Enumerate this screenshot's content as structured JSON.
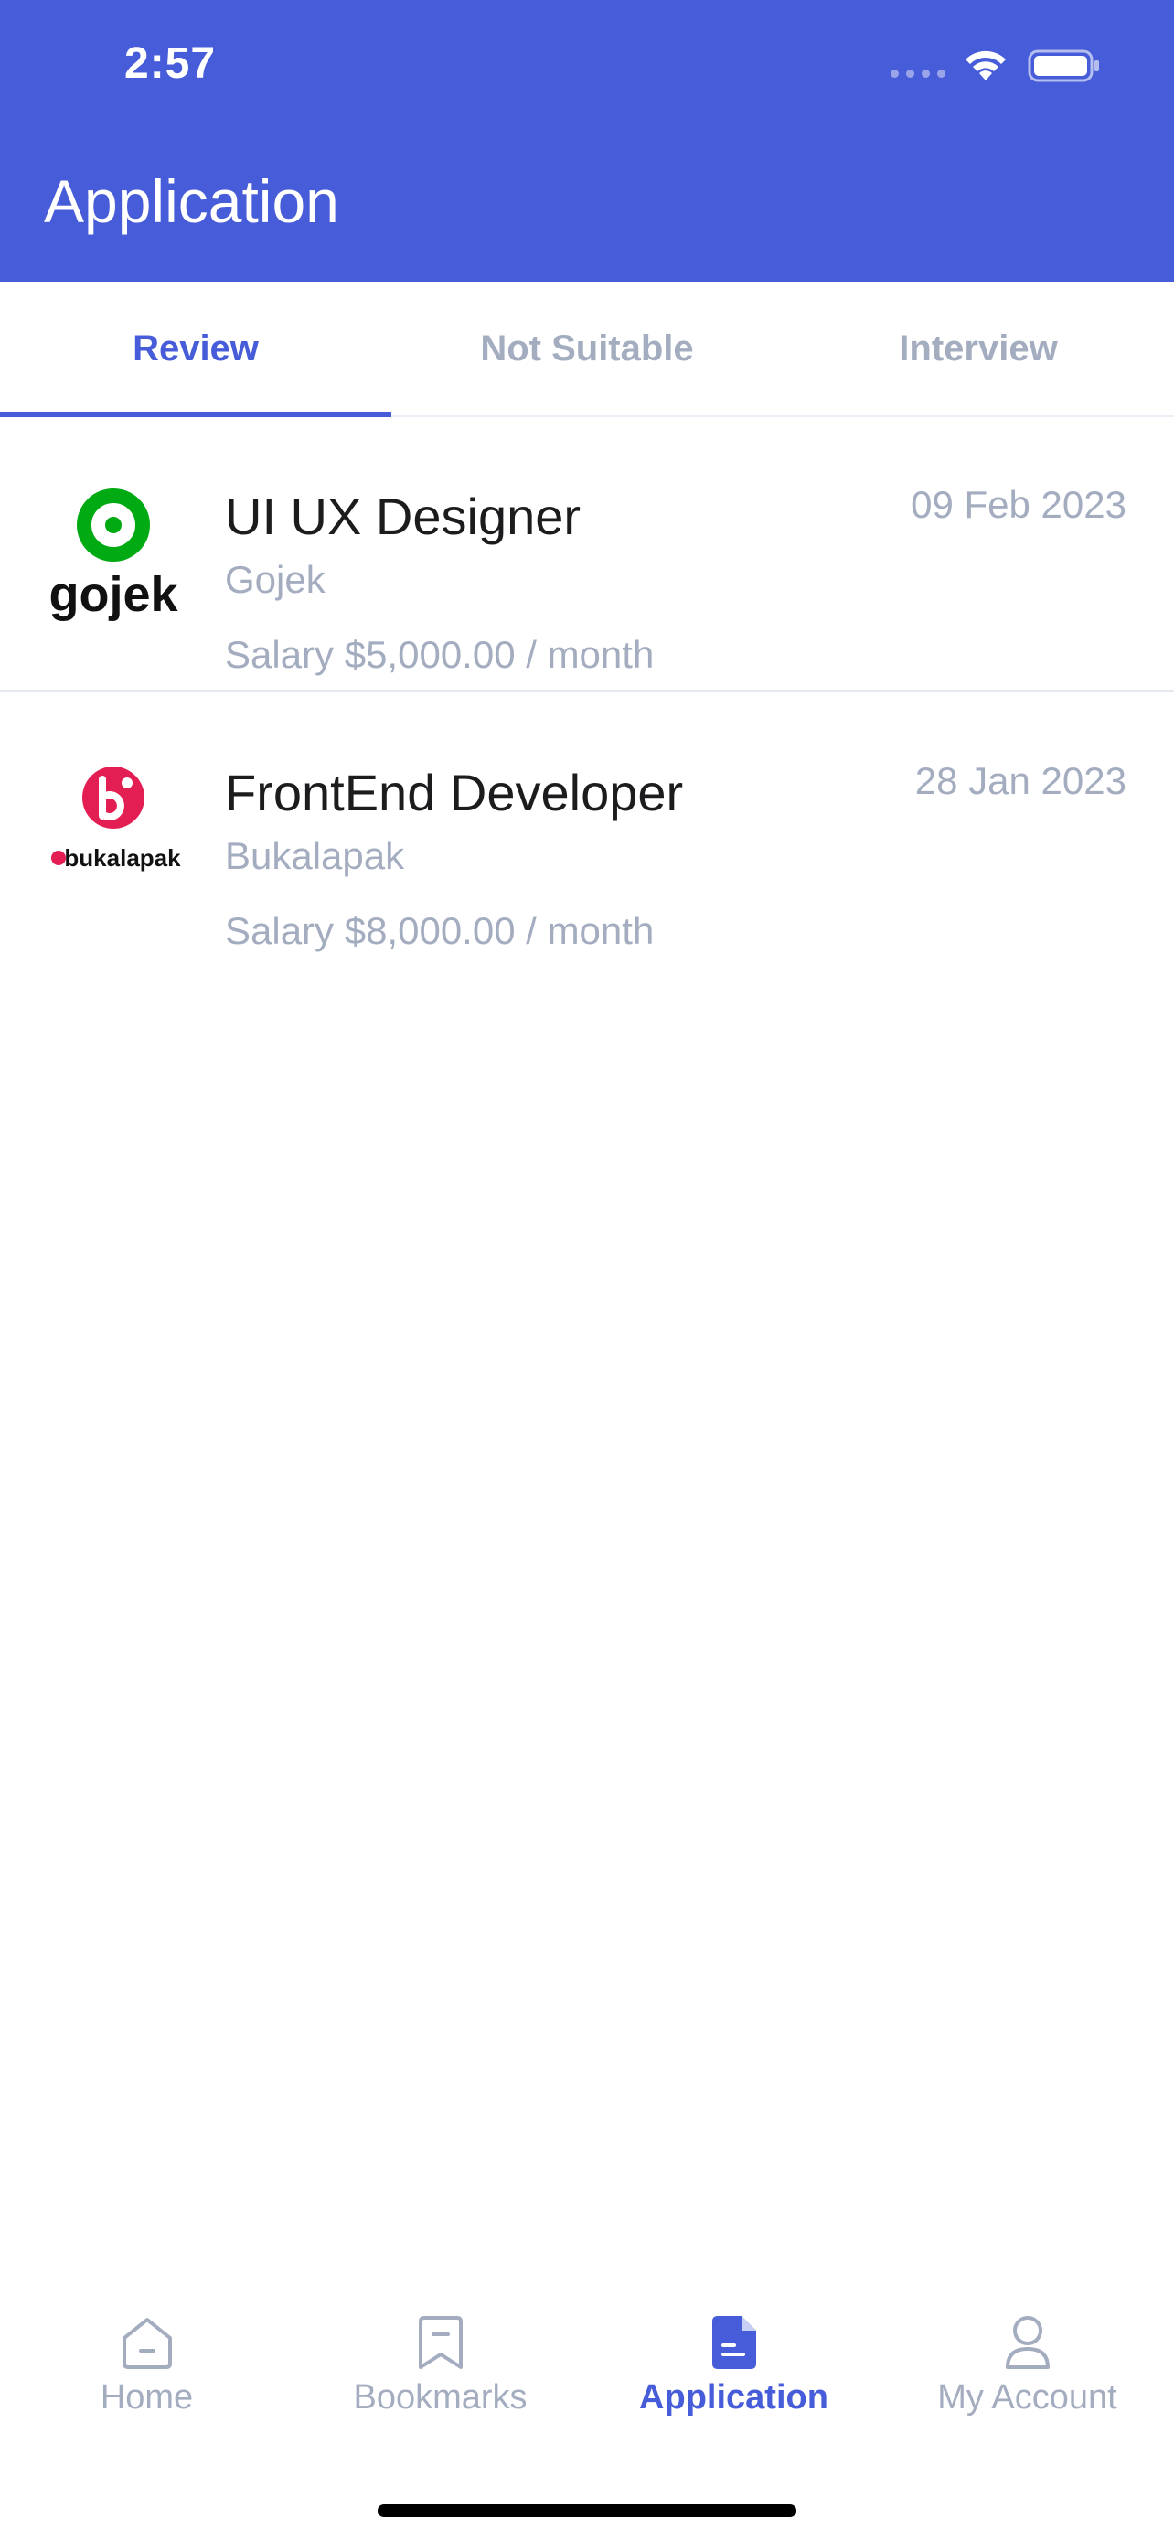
{
  "status_bar": {
    "time": "2:57"
  },
  "header": {
    "title": "Application"
  },
  "tabs": [
    {
      "label": "Review",
      "active": true
    },
    {
      "label": "Not Suitable",
      "active": false
    },
    {
      "label": "Interview",
      "active": false
    }
  ],
  "jobs": [
    {
      "title": "UI UX Designer",
      "company": "Gojek",
      "salary": "Salary $5,000.00 / month",
      "date": "09 Feb 2023",
      "logo_text": "gojek"
    },
    {
      "title": "FrontEnd Developer",
      "company": "Bukalapak",
      "salary": "Salary $8,000.00 / month",
      "date": "28 Jan 2023",
      "logo_text": "bukalapak"
    }
  ],
  "bottom_nav": [
    {
      "label": "Home",
      "icon": "home-icon",
      "active": false
    },
    {
      "label": "Bookmarks",
      "icon": "bookmark-icon",
      "active": false
    },
    {
      "label": "Application",
      "icon": "document-icon",
      "active": true
    },
    {
      "label": "My Account",
      "icon": "user-icon",
      "active": false
    }
  ],
  "colors": {
    "primary": "#475cd8",
    "muted": "#a4adc0",
    "gojek_green": "#00aa13",
    "bukalapak_red": "#e31e52"
  }
}
